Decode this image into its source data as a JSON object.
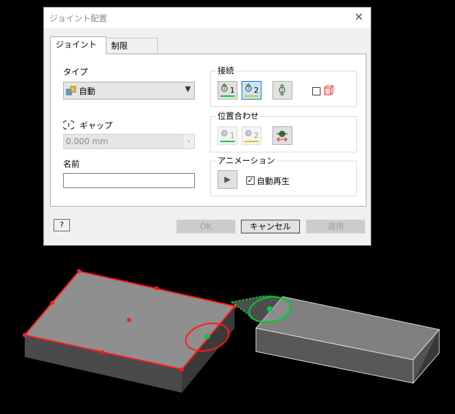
{
  "dialog": {
    "title": "ジョイント配置",
    "close_glyph": "✕",
    "tabs": [
      {
        "label": "ジョイント",
        "active": true
      },
      {
        "label": "制限",
        "active": false
      }
    ],
    "type": {
      "label": "タイプ",
      "value": "自動"
    },
    "gap": {
      "label": "ギャップ",
      "value": "0.000 mm",
      "spin_glyph": "›"
    },
    "name": {
      "label": "名前",
      "value": ""
    },
    "connect": {
      "label": "接続",
      "buttons": [
        {
          "icon": "connect-point-1-icon",
          "text": "1",
          "state": "normal"
        },
        {
          "icon": "connect-point-2-icon",
          "text": "2",
          "state": "selected"
        },
        {
          "icon": "flip-icon",
          "text": "",
          "state": "normal"
        }
      ],
      "isolate_checked": false
    },
    "align": {
      "label": "位置合わせ",
      "buttons": [
        {
          "icon": "align-1-icon",
          "text": "1",
          "state": "disabled"
        },
        {
          "icon": "align-2-icon",
          "text": "2",
          "state": "disabled"
        },
        {
          "icon": "invert-alignment-icon",
          "text": "",
          "state": "normal"
        }
      ]
    },
    "animation": {
      "label": "アニメーション",
      "play_glyph": "▶",
      "autoplay_label": "自動再生",
      "autoplay_checked": true
    },
    "buttons": {
      "help": "?",
      "ok": "OK",
      "cancel": "キャンセル",
      "apply": "適用"
    }
  },
  "colors": {
    "accent_blue": "#0078d7",
    "selection_red": "#ff0000",
    "selection_green": "#00cc33",
    "part_gray": "#9a9a9a"
  }
}
